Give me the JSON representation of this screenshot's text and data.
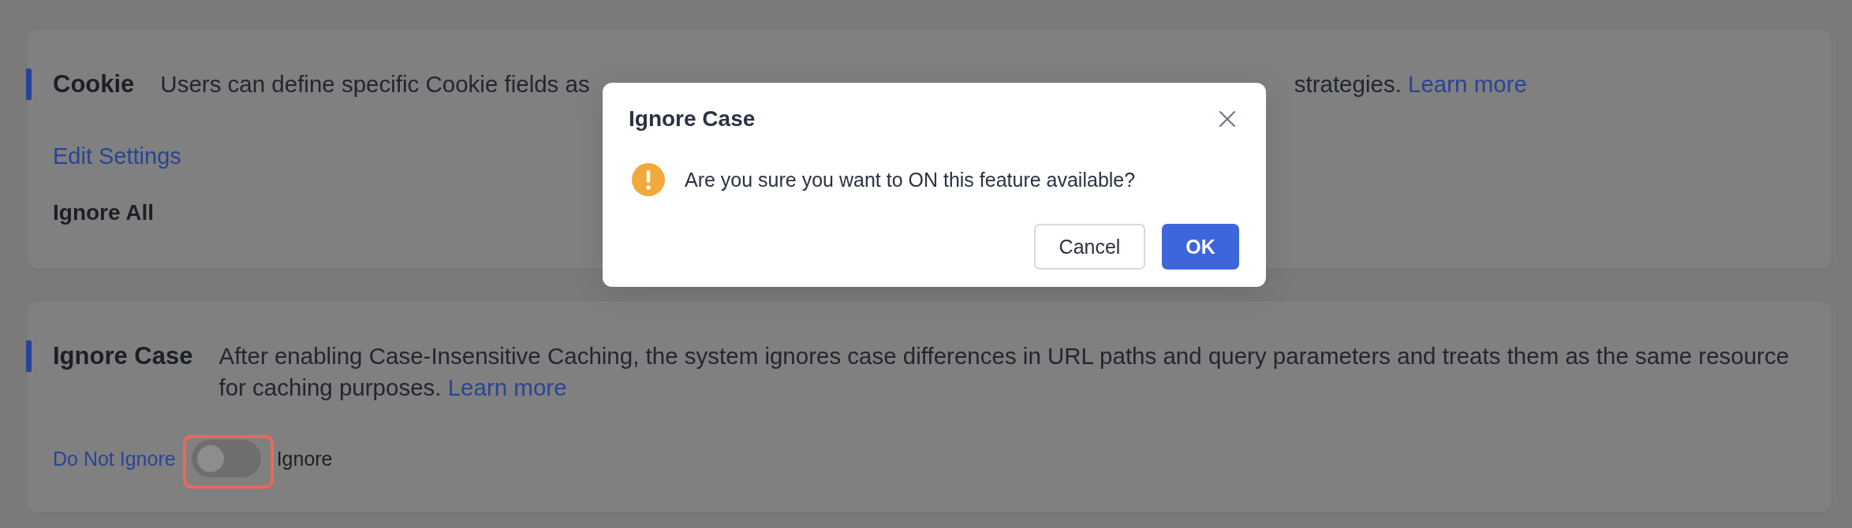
{
  "sections": [
    {
      "title": "Cookie",
      "description": [
        "Users can define specific Cookie fields as",
        "strategies."
      ],
      "learn_more": "Learn more",
      "edit_link": "Edit Settings",
      "value": "Ignore All"
    },
    {
      "title": "Ignore Case",
      "description": [
        "After enabling Case-Insensitive Caching, the system ignores case differences in URL paths and query parameters and treats them as the same resource for caching purposes."
      ],
      "learn_more": "Learn more",
      "toggle": {
        "off_label": "Do Not Ignore",
        "on_label": "Ignore",
        "on": false,
        "highlighted": true
      }
    }
  ],
  "dialog": {
    "title": "Ignore Case",
    "message": "Are you sure you want to ON this feature available?",
    "buttons": [
      {
        "label": "Cancel",
        "kind": "secondary"
      },
      {
        "label": "OK",
        "kind": "primary"
      }
    ]
  }
}
